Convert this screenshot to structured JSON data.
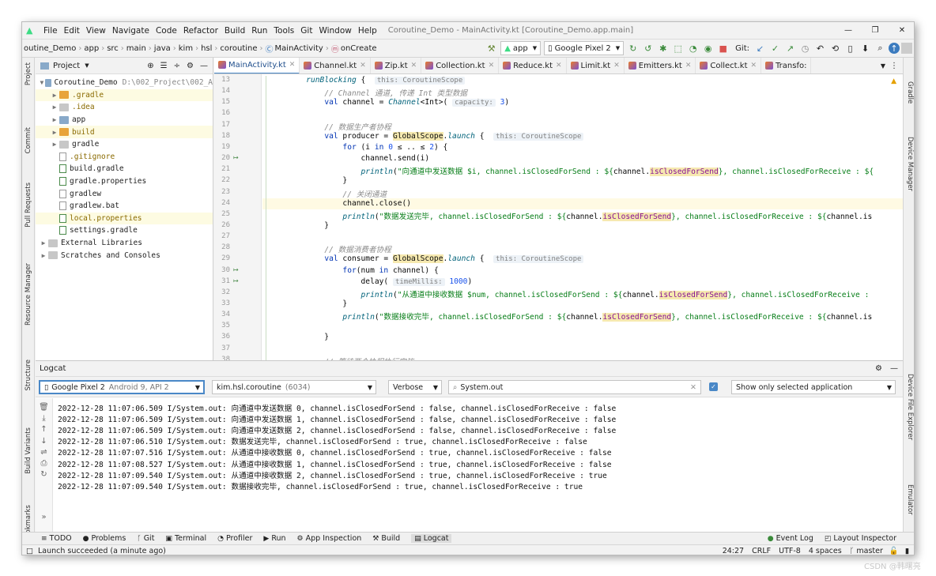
{
  "window": {
    "title": "Coroutine_Demo - MainActivity.kt [Coroutine_Demo.app.main]"
  },
  "menu": [
    "File",
    "Edit",
    "View",
    "Navigate",
    "Code",
    "Refactor",
    "Build",
    "Run",
    "Tools",
    "Git",
    "Window",
    "Help"
  ],
  "breadcrumbs": [
    "outine_Demo",
    "app",
    "src",
    "main",
    "java",
    "kim",
    "hsl",
    "coroutine",
    "MainActivity",
    "onCreate"
  ],
  "toolbar": {
    "run_config": "app",
    "device": "Google Pixel 2",
    "git_label": "Git:"
  },
  "project_panel": {
    "title": "Project",
    "root": {
      "name": "Coroutine_Demo",
      "path": "D:\\002_Project\\002_A"
    },
    "items": [
      {
        "name": ".gradle",
        "icon": "folder-orange",
        "expandable": true,
        "highlighted": true
      },
      {
        "name": ".idea",
        "icon": "folder-gray",
        "expandable": true,
        "highlighted": false
      },
      {
        "name": "app",
        "icon": "folder-blue",
        "expandable": true,
        "highlighted": false
      },
      {
        "name": "build",
        "icon": "folder-orange",
        "expandable": true,
        "highlighted": true
      },
      {
        "name": "gradle",
        "icon": "folder-gray",
        "expandable": true,
        "highlighted": false
      },
      {
        "name": ".gitignore",
        "icon": "file",
        "expandable": false,
        "highlighted": false
      },
      {
        "name": "build.gradle",
        "icon": "gradle",
        "expandable": false,
        "highlighted": false
      },
      {
        "name": "gradle.properties",
        "icon": "gradle",
        "expandable": false,
        "highlighted": false
      },
      {
        "name": "gradlew",
        "icon": "file",
        "expandable": false,
        "highlighted": false
      },
      {
        "name": "gradlew.bat",
        "icon": "file",
        "expandable": false,
        "highlighted": false
      },
      {
        "name": "local.properties",
        "icon": "gradle",
        "expandable": false,
        "highlighted": true
      },
      {
        "name": "settings.gradle",
        "icon": "gradle",
        "expandable": false,
        "highlighted": false
      }
    ],
    "extra": [
      "External Libraries",
      "Scratches and Consoles"
    ]
  },
  "editor_tabs": [
    "MainActivity.kt",
    "Channel.kt",
    "Zip.kt",
    "Collection.kt",
    "Reduce.kt",
    "Limit.kt",
    "Emitters.kt",
    "Collect.kt",
    "Transfo:"
  ],
  "active_tab": 0,
  "code": {
    "current_line": 24,
    "lines": [
      {
        "n": 13,
        "html": "        <span class=\"fn\">runBlocking</span> {  <span class=\"hint\">this: CoroutineScope</span>"
      },
      {
        "n": 14,
        "html": "            <span class=\"cm\">// Channel 通道, 传递 Int 类型数据</span>"
      },
      {
        "n": 15,
        "html": "            <span class=\"kw\">val</span> channel = <span class=\"fn\">Channel</span>&lt;Int&gt;( <span class=\"hint\">capacity:</span> <span class=\"nm\">3</span>)"
      },
      {
        "n": 16,
        "html": ""
      },
      {
        "n": 17,
        "html": "            <span class=\"cm\">// 数据生产者协程</span>"
      },
      {
        "n": 18,
        "html": "            <span class=\"kw\">val</span> producer = <span class=\"hl\">GlobalScope</span>.<span class=\"fn\">launch</span> {  <span class=\"hint\">this: CoroutineScope</span>"
      },
      {
        "n": 19,
        "html": "                <span class=\"kw\">for</span> (i <span class=\"kw\">in</span> <span class=\"nm\">0</span> ≤ .. ≤ <span class=\"nm\">2</span>) {"
      },
      {
        "n": 20,
        "html": "                    channel.send(i)"
      },
      {
        "n": 21,
        "html": "                    <span class=\"fn\">println</span>(<span class=\"st\">\"向通道中发送数据 $i, channel.isClosedForSend : ${</span>channel.<span class=\"hl prop\">isClosedForSend</span><span class=\"st\">}, channel.isClosedForReceive : ${</span>"
      },
      {
        "n": 22,
        "html": "                }"
      },
      {
        "n": 23,
        "html": "                <span class=\"cm\">// 关闭通道</span>"
      },
      {
        "n": 24,
        "html": "                channel.close()"
      },
      {
        "n": 25,
        "html": "                <span class=\"fn\">println</span>(<span class=\"st\">\"数据发送完毕, channel.isClosedForSend : ${</span>channel.<span class=\"hl prop\">isClosedForSend</span><span class=\"st\">}, channel.isClosedForReceive : ${</span>channel.is"
      },
      {
        "n": 26,
        "html": "            }"
      },
      {
        "n": 27,
        "html": ""
      },
      {
        "n": 28,
        "html": "            <span class=\"cm\">// 数据消费者协程</span>"
      },
      {
        "n": 29,
        "html": "            <span class=\"kw\">val</span> consumer = <span class=\"hl\">GlobalScope</span>.<span class=\"fn\">launch</span> {  <span class=\"hint\">this: CoroutineScope</span>"
      },
      {
        "n": 30,
        "html": "                <span class=\"kw\">for</span>(num <span class=\"kw\">in</span> channel) {"
      },
      {
        "n": 31,
        "html": "                    delay( <span class=\"hint\">timeMillis:</span> <span class=\"nm\">1000</span>)"
      },
      {
        "n": 32,
        "html": "                    <span class=\"fn\">println</span>(<span class=\"st\">\"从通道中接收数据 $num, channel.isClosedForSend : ${</span>channel.<span class=\"hl prop\">isClosedForSend</span><span class=\"st\">}, channel.isClosedForReceive :</span>"
      },
      {
        "n": 33,
        "html": "                }"
      },
      {
        "n": 34,
        "html": "                <span class=\"fn\">println</span>(<span class=\"st\">\"数据接收完毕, channel.isClosedForSend : ${</span>channel.<span class=\"hl prop\">isClosedForSend</span><span class=\"st\">}, channel.isClosedForReceive : ${</span>channel.is"
      },
      {
        "n": 35,
        "html": ""
      },
      {
        "n": 36,
        "html": "            }"
      },
      {
        "n": 37,
        "html": ""
      },
      {
        "n": 38,
        "html": "            <span class=\"cm\">// 等待两个协程执行完毕</span>"
      }
    ]
  },
  "logcat": {
    "title": "Logcat",
    "device": "Google Pixel 2",
    "device_detail": "Android 9, API 2",
    "process": "kim.hsl.coroutine",
    "pid": "(6034)",
    "level": "Verbose",
    "search": "System.out",
    "show_only": "Show only selected application",
    "lines": [
      "2022-12-28 11:07:06.509 I/System.out: 向通道中发送数据 0, channel.isClosedForSend : false, channel.isClosedForReceive : false",
      "2022-12-28 11:07:06.509 I/System.out: 向通道中发送数据 1, channel.isClosedForSend : false, channel.isClosedForReceive : false",
      "2022-12-28 11:07:06.509 I/System.out: 向通道中发送数据 2, channel.isClosedForSend : false, channel.isClosedForReceive : false",
      "2022-12-28 11:07:06.510 I/System.out: 数据发送完毕, channel.isClosedForSend : true, channel.isClosedForReceive : false",
      "2022-12-28 11:07:07.516 I/System.out: 从通道中接收数据 0, channel.isClosedForSend : true, channel.isClosedForReceive : false",
      "2022-12-28 11:07:08.527 I/System.out: 从通道中接收数据 1, channel.isClosedForSend : true, channel.isClosedForReceive : false",
      "2022-12-28 11:07:09.540 I/System.out: 从通道中接收数据 2, channel.isClosedForSend : true, channel.isClosedForReceive : true",
      "2022-12-28 11:07:09.540 I/System.out: 数据接收完毕, channel.isClosedForSend : true, channel.isClosedForReceive : true"
    ]
  },
  "left_tools": [
    "Project",
    "Commit",
    "Pull Requests",
    "Resource Manager",
    "Structure",
    "Build Variants",
    "Bookmarks"
  ],
  "right_tools": [
    "Gradle",
    "Device Manager",
    "Device File Explorer",
    "Emulator"
  ],
  "bottom_tabs": [
    {
      "label": "TODO",
      "icon": "≡"
    },
    {
      "label": "Problems",
      "icon": "●"
    },
    {
      "label": "Git",
      "icon": "ᚴ"
    },
    {
      "label": "Terminal",
      "icon": "▣"
    },
    {
      "label": "Profiler",
      "icon": "◔"
    },
    {
      "label": "Run",
      "icon": "▶"
    },
    {
      "label": "App Inspection",
      "icon": "⚙"
    },
    {
      "label": "Build",
      "icon": "⚒"
    },
    {
      "label": "Logcat",
      "icon": "▤"
    }
  ],
  "bottom_right_tabs": [
    {
      "label": "Event Log",
      "icon": "●"
    },
    {
      "label": "Layout Inspector",
      "icon": "◰"
    }
  ],
  "status": {
    "message": "Launch succeeded (a minute ago)",
    "position": "24:27",
    "line_sep": "CRLF",
    "encoding": "UTF-8",
    "indent": "4 spaces",
    "branch": "master"
  },
  "watermark": "CSDN @韩曙亮",
  "colors": {
    "accent": "#4a88c7",
    "android_green": "#3ddc84",
    "run_red": "#d9534f",
    "git_blue": "#3b7bbf"
  }
}
